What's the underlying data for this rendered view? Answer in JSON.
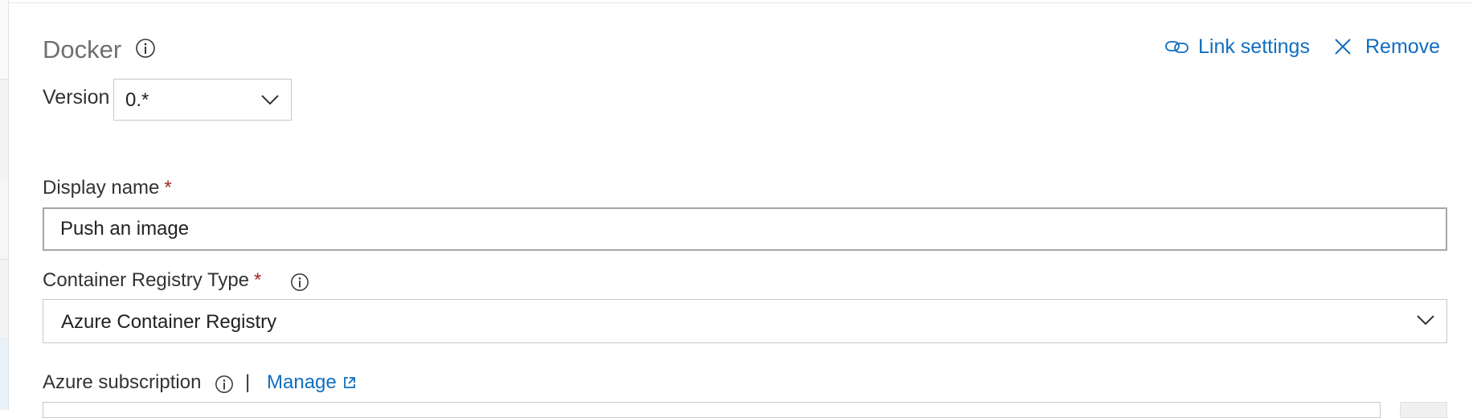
{
  "task": {
    "title": "Docker",
    "link_settings": "Link settings",
    "remove": "Remove"
  },
  "version": {
    "label": "Version",
    "value": "0.*"
  },
  "display_name": {
    "label": "Display name",
    "required": "*",
    "value": "Push an image"
  },
  "registry_type": {
    "label": "Container Registry Type",
    "required": "*",
    "value": "Azure Container Registry"
  },
  "subscription": {
    "label": "Azure subscription",
    "separator": "|",
    "manage": "Manage"
  },
  "colors": {
    "link": "#106ebe",
    "required": "#a4262c",
    "title": "#707070"
  }
}
